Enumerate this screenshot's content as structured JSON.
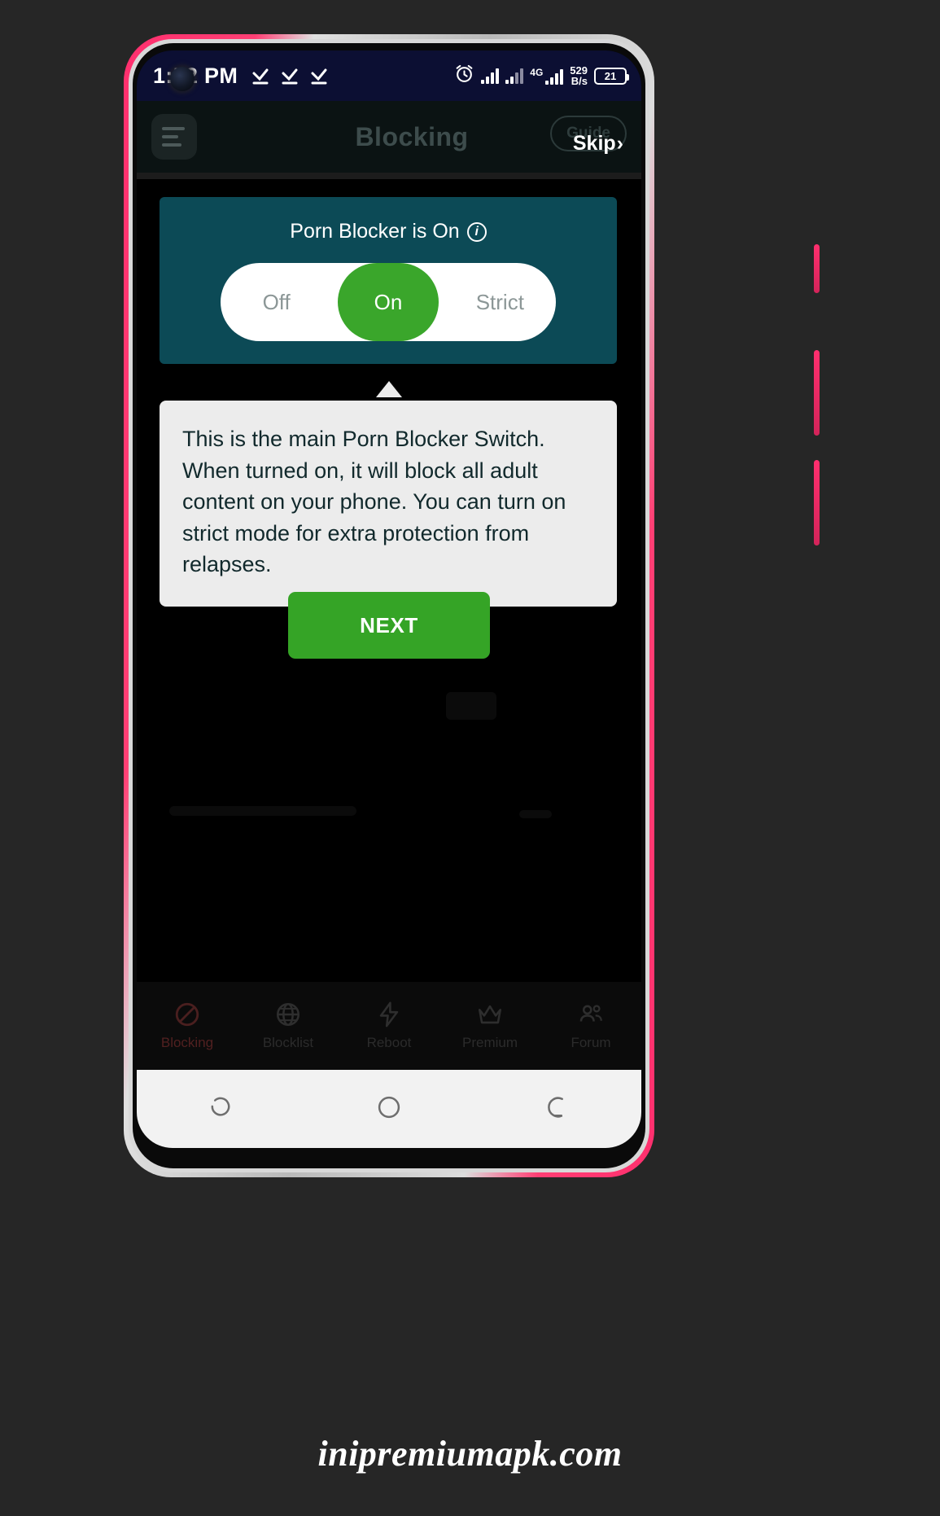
{
  "status_bar": {
    "time": "1:52 PM",
    "check_icons": [
      "check-icon",
      "check-icon",
      "check-icon"
    ],
    "alarm_icon": "alarm-clock-icon",
    "signal_icon": "signal-bars-icon",
    "signal_alt_icon": "signal-bars-icon",
    "network_type": "4G",
    "data_speed_value": "529",
    "data_speed_unit": "B/s",
    "battery_percent": "21"
  },
  "app_bar": {
    "menu_icon": "hamburger-menu-icon",
    "title": "Blocking",
    "guide_label": "Guide",
    "skip_label": "Skip",
    "skip_chevron": "›"
  },
  "spotlight": {
    "card_title": "Porn Blocker is On",
    "info_icon": "info-icon",
    "info_glyph": "i",
    "segments": [
      {
        "label": "Off",
        "active": false
      },
      {
        "label": "On",
        "active": true
      },
      {
        "label": "Strict",
        "active": false
      }
    ],
    "card_bg": "#0c4a56",
    "active_color": "#3aa62b"
  },
  "tooltip": {
    "body": "This is the main Porn Blocker Switch. When turned on, it will block all adult content on your phone. You can turn on strict mode for extra protection from relapses.",
    "pointer_icon": "triangle-up-icon",
    "bg": "#ececec",
    "text_color": "#11292c"
  },
  "next_button": {
    "label": "NEXT",
    "color": "#35a426"
  },
  "tab_bar": {
    "items": [
      {
        "label": "Blocking",
        "icon": "block-circle-icon",
        "active": true
      },
      {
        "label": "Blocklist",
        "icon": "globe-icon",
        "active": false
      },
      {
        "label": "Reboot",
        "icon": "lightning-bolt-icon",
        "active": false
      },
      {
        "label": "Premium",
        "icon": "crown-icon",
        "active": false
      },
      {
        "label": "Forum",
        "icon": "people-group-icon",
        "active": false
      }
    ]
  },
  "nav_bar": {
    "buttons": [
      {
        "icon": "recents-icon"
      },
      {
        "icon": "home-circle-icon"
      },
      {
        "icon": "back-icon"
      }
    ]
  },
  "watermark": {
    "text": "inipremiumapk.com"
  }
}
